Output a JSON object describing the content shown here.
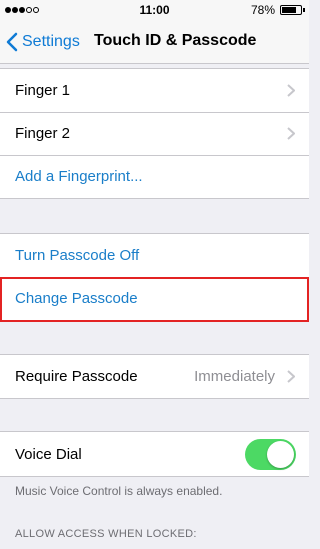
{
  "status_bar": {
    "time": "11:00",
    "battery_percent": "78%",
    "battery_level": 0.78,
    "signal_bars_filled": 3,
    "signal_bars_total": 5
  },
  "nav": {
    "back_label": "Settings",
    "title": "Touch ID & Passcode",
    "back_icon": "chevron-left-icon"
  },
  "fingerprints": {
    "items": [
      {
        "label": "Finger 1"
      },
      {
        "label": "Finger 2"
      }
    ],
    "add_label": "Add a Fingerprint..."
  },
  "passcode": {
    "turn_off_label": "Turn Passcode Off",
    "change_label": "Change Passcode"
  },
  "require": {
    "label": "Require Passcode",
    "value": "Immediately"
  },
  "voice_dial": {
    "label": "Voice Dial",
    "enabled": true,
    "footnote": "Music Voice Control is always enabled."
  },
  "allow_access_header": "ALLOW ACCESS WHEN LOCKED:",
  "colors": {
    "accent": "#1a7ec9",
    "toggle_on": "#4cd964",
    "highlight": "#e32323"
  }
}
